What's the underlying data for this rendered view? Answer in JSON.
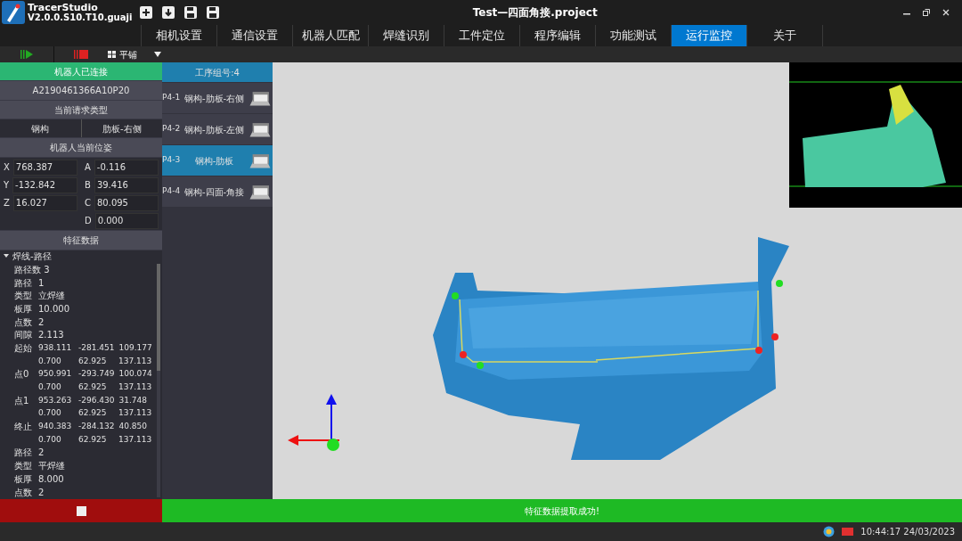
{
  "app": {
    "name": "TracerStudio",
    "version": "V2.0.0.S10.T10.guaji"
  },
  "window": {
    "title": "Test—四面角接.project"
  },
  "tabs": [
    {
      "label": "相机设置",
      "selected": false
    },
    {
      "label": "通信设置",
      "selected": false
    },
    {
      "label": "机器人匹配",
      "selected": false
    },
    {
      "label": "焊缝识别",
      "selected": false
    },
    {
      "label": "工件定位",
      "selected": false
    },
    {
      "label": "程序编辑",
      "selected": false
    },
    {
      "label": "功能测试",
      "selected": false
    },
    {
      "label": "运行监控",
      "selected": true
    },
    {
      "label": "关于",
      "selected": false
    }
  ],
  "toolbar": {
    "layout_label": "平铺"
  },
  "robot_panel": {
    "status": "机器人已连接",
    "connected": true,
    "serial": "A2190461366A10P20",
    "request_type_heading": "当前请求类型",
    "request_type": [
      "钢构",
      "肋板-右侧"
    ],
    "pose_heading": "机器人当前位姿",
    "pose": [
      {
        "label": "X",
        "value": "768.387"
      },
      {
        "label": "A",
        "value": "-0.116"
      },
      {
        "label": "Y",
        "value": "-132.842"
      },
      {
        "label": "B",
        "value": "39.416"
      },
      {
        "label": "Z",
        "value": "16.027"
      },
      {
        "label": "C",
        "value": "80.095"
      },
      {
        "label": "D",
        "value": "0.000"
      }
    ],
    "feature_heading": "特征数据",
    "tree": {
      "label": "焊线-路径",
      "expanded": true,
      "rows": [
        {
          "label": "路径数 3",
          "values": []
        },
        {
          "label": "路径",
          "values": [
            "1"
          ]
        },
        {
          "label": "类型",
          "values": [
            "立焊缝"
          ]
        },
        {
          "label": "板厚",
          "values": [
            "10.000"
          ]
        },
        {
          "label": "点数",
          "values": [
            "2"
          ]
        },
        {
          "label": "间隙",
          "values": [
            "2.113"
          ]
        },
        {
          "label": "起始",
          "values": [
            "938.111",
            "-281.451",
            "109.177"
          ]
        },
        {
          "label": "",
          "values": [
            "0.700",
            "62.925",
            "137.113"
          ]
        },
        {
          "label": "点0",
          "values": [
            "950.991",
            "-293.749",
            "100.074"
          ]
        },
        {
          "label": "",
          "values": [
            "0.700",
            "62.925",
            "137.113"
          ]
        },
        {
          "label": "点1",
          "values": [
            "953.263",
            "-296.430",
            "31.748"
          ]
        },
        {
          "label": "",
          "values": [
            "0.700",
            "62.925",
            "137.113"
          ]
        },
        {
          "label": "终止",
          "values": [
            "940.383",
            "-284.132",
            "40.850"
          ]
        },
        {
          "label": "",
          "values": [
            "0.700",
            "62.925",
            "137.113"
          ]
        },
        {
          "label": "路径",
          "values": [
            "2"
          ]
        },
        {
          "label": "类型",
          "values": [
            "平焊缝"
          ]
        },
        {
          "label": "板厚",
          "values": [
            "8.000"
          ]
        },
        {
          "label": "点数",
          "values": [
            "2"
          ]
        }
      ]
    }
  },
  "process_list": {
    "heading": "工序组号:4",
    "items": [
      {
        "code": "P4-1",
        "name": "钢构-肋板-右侧",
        "selected": false
      },
      {
        "code": "P4-2",
        "name": "钢构-肋板-左侧",
        "selected": false
      },
      {
        "code": "P4-3",
        "name": "钢构-肋板",
        "selected": true
      },
      {
        "code": "P4-4",
        "name": "钢构-四面-角接",
        "selected": false
      }
    ]
  },
  "status_message": "特征数据提取成功!",
  "status_bar": {
    "clock": "10:44:17 24/03/2023"
  }
}
